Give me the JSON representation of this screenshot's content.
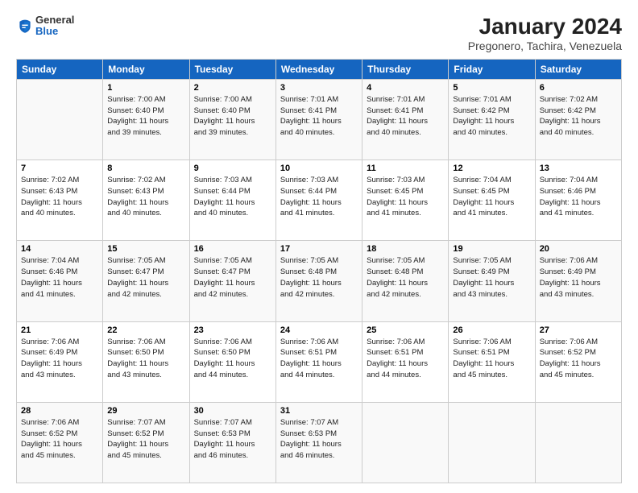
{
  "header": {
    "logo_general": "General",
    "logo_blue": "Blue",
    "month_title": "January 2024",
    "location": "Pregonero, Tachira, Venezuela"
  },
  "columns": [
    "Sunday",
    "Monday",
    "Tuesday",
    "Wednesday",
    "Thursday",
    "Friday",
    "Saturday"
  ],
  "weeks": [
    [
      {
        "num": "",
        "detail": ""
      },
      {
        "num": "1",
        "detail": "Sunrise: 7:00 AM\nSunset: 6:40 PM\nDaylight: 11 hours\nand 39 minutes."
      },
      {
        "num": "2",
        "detail": "Sunrise: 7:00 AM\nSunset: 6:40 PM\nDaylight: 11 hours\nand 39 minutes."
      },
      {
        "num": "3",
        "detail": "Sunrise: 7:01 AM\nSunset: 6:41 PM\nDaylight: 11 hours\nand 40 minutes."
      },
      {
        "num": "4",
        "detail": "Sunrise: 7:01 AM\nSunset: 6:41 PM\nDaylight: 11 hours\nand 40 minutes."
      },
      {
        "num": "5",
        "detail": "Sunrise: 7:01 AM\nSunset: 6:42 PM\nDaylight: 11 hours\nand 40 minutes."
      },
      {
        "num": "6",
        "detail": "Sunrise: 7:02 AM\nSunset: 6:42 PM\nDaylight: 11 hours\nand 40 minutes."
      }
    ],
    [
      {
        "num": "7",
        "detail": "Sunrise: 7:02 AM\nSunset: 6:43 PM\nDaylight: 11 hours\nand 40 minutes."
      },
      {
        "num": "8",
        "detail": "Sunrise: 7:02 AM\nSunset: 6:43 PM\nDaylight: 11 hours\nand 40 minutes."
      },
      {
        "num": "9",
        "detail": "Sunrise: 7:03 AM\nSunset: 6:44 PM\nDaylight: 11 hours\nand 40 minutes."
      },
      {
        "num": "10",
        "detail": "Sunrise: 7:03 AM\nSunset: 6:44 PM\nDaylight: 11 hours\nand 41 minutes."
      },
      {
        "num": "11",
        "detail": "Sunrise: 7:03 AM\nSunset: 6:45 PM\nDaylight: 11 hours\nand 41 minutes."
      },
      {
        "num": "12",
        "detail": "Sunrise: 7:04 AM\nSunset: 6:45 PM\nDaylight: 11 hours\nand 41 minutes."
      },
      {
        "num": "13",
        "detail": "Sunrise: 7:04 AM\nSunset: 6:46 PM\nDaylight: 11 hours\nand 41 minutes."
      }
    ],
    [
      {
        "num": "14",
        "detail": "Sunrise: 7:04 AM\nSunset: 6:46 PM\nDaylight: 11 hours\nand 41 minutes."
      },
      {
        "num": "15",
        "detail": "Sunrise: 7:05 AM\nSunset: 6:47 PM\nDaylight: 11 hours\nand 42 minutes."
      },
      {
        "num": "16",
        "detail": "Sunrise: 7:05 AM\nSunset: 6:47 PM\nDaylight: 11 hours\nand 42 minutes."
      },
      {
        "num": "17",
        "detail": "Sunrise: 7:05 AM\nSunset: 6:48 PM\nDaylight: 11 hours\nand 42 minutes."
      },
      {
        "num": "18",
        "detail": "Sunrise: 7:05 AM\nSunset: 6:48 PM\nDaylight: 11 hours\nand 42 minutes."
      },
      {
        "num": "19",
        "detail": "Sunrise: 7:05 AM\nSunset: 6:49 PM\nDaylight: 11 hours\nand 43 minutes."
      },
      {
        "num": "20",
        "detail": "Sunrise: 7:06 AM\nSunset: 6:49 PM\nDaylight: 11 hours\nand 43 minutes."
      }
    ],
    [
      {
        "num": "21",
        "detail": "Sunrise: 7:06 AM\nSunset: 6:49 PM\nDaylight: 11 hours\nand 43 minutes."
      },
      {
        "num": "22",
        "detail": "Sunrise: 7:06 AM\nSunset: 6:50 PM\nDaylight: 11 hours\nand 43 minutes."
      },
      {
        "num": "23",
        "detail": "Sunrise: 7:06 AM\nSunset: 6:50 PM\nDaylight: 11 hours\nand 44 minutes."
      },
      {
        "num": "24",
        "detail": "Sunrise: 7:06 AM\nSunset: 6:51 PM\nDaylight: 11 hours\nand 44 minutes."
      },
      {
        "num": "25",
        "detail": "Sunrise: 7:06 AM\nSunset: 6:51 PM\nDaylight: 11 hours\nand 44 minutes."
      },
      {
        "num": "26",
        "detail": "Sunrise: 7:06 AM\nSunset: 6:51 PM\nDaylight: 11 hours\nand 45 minutes."
      },
      {
        "num": "27",
        "detail": "Sunrise: 7:06 AM\nSunset: 6:52 PM\nDaylight: 11 hours\nand 45 minutes."
      }
    ],
    [
      {
        "num": "28",
        "detail": "Sunrise: 7:06 AM\nSunset: 6:52 PM\nDaylight: 11 hours\nand 45 minutes."
      },
      {
        "num": "29",
        "detail": "Sunrise: 7:07 AM\nSunset: 6:52 PM\nDaylight: 11 hours\nand 45 minutes."
      },
      {
        "num": "30",
        "detail": "Sunrise: 7:07 AM\nSunset: 6:53 PM\nDaylight: 11 hours\nand 46 minutes."
      },
      {
        "num": "31",
        "detail": "Sunrise: 7:07 AM\nSunset: 6:53 PM\nDaylight: 11 hours\nand 46 minutes."
      },
      {
        "num": "",
        "detail": ""
      },
      {
        "num": "",
        "detail": ""
      },
      {
        "num": "",
        "detail": ""
      }
    ]
  ]
}
